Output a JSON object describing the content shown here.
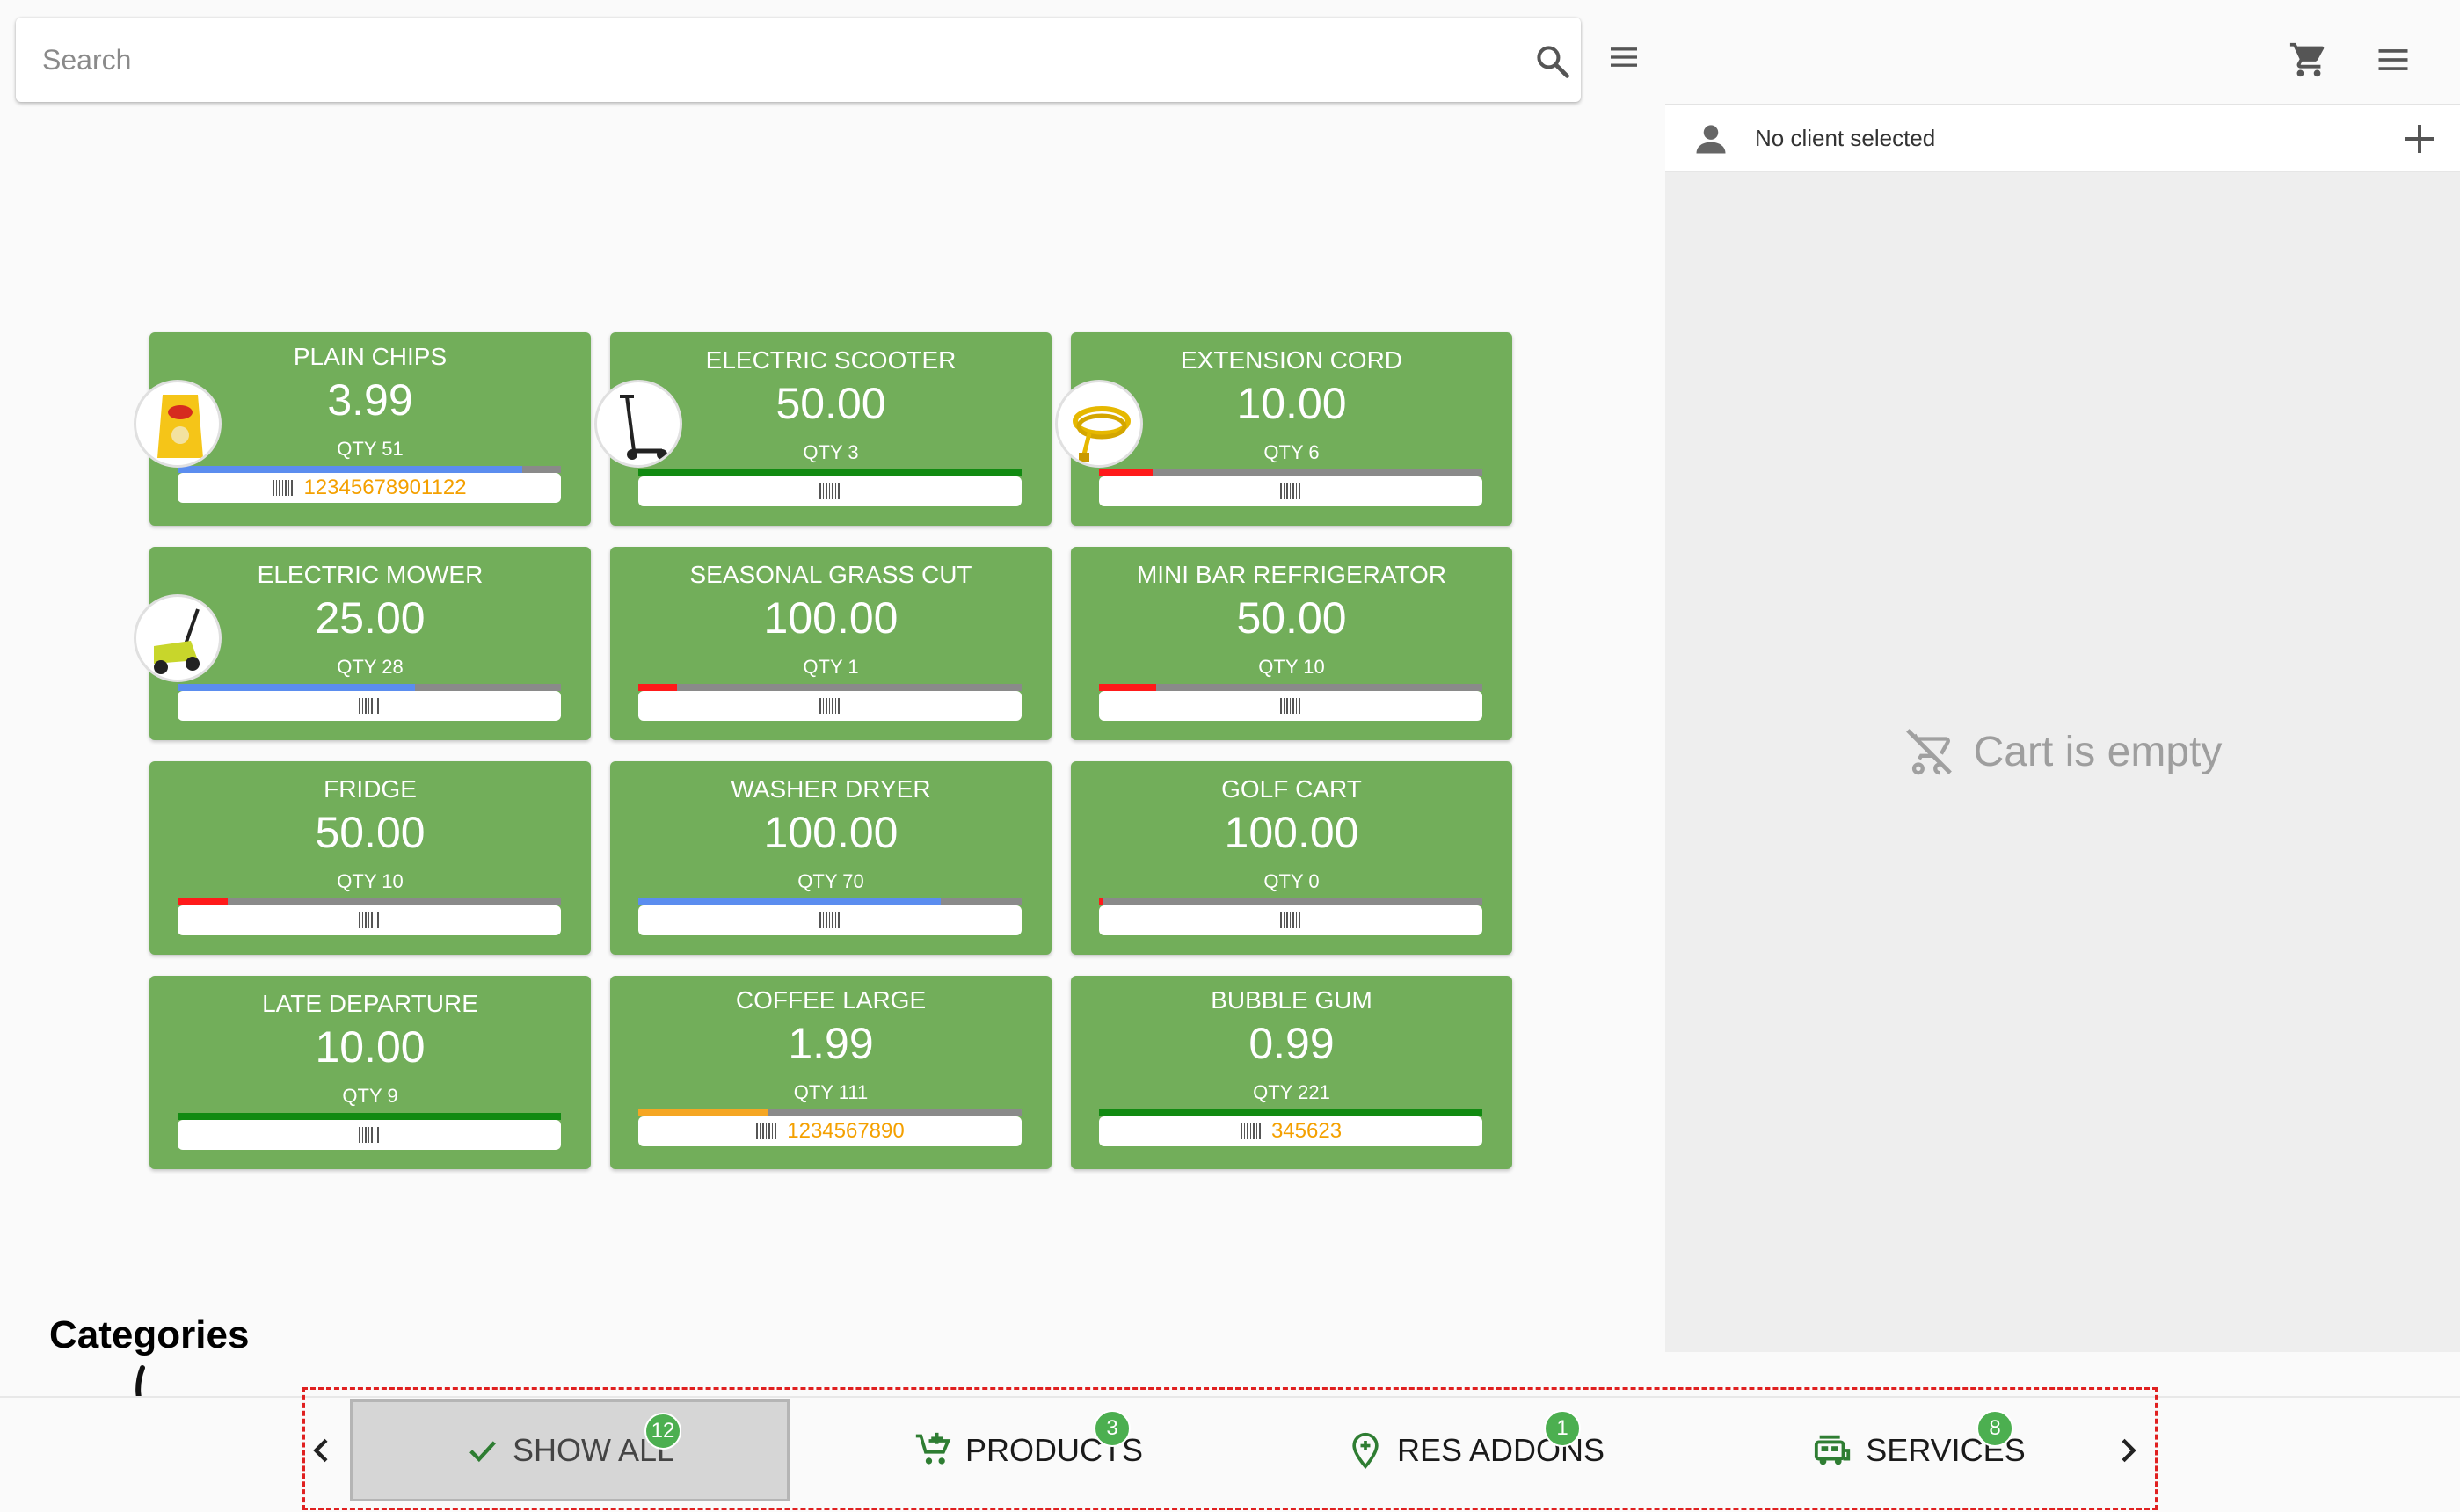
{
  "search": {
    "placeholder": "Search"
  },
  "client": {
    "label": "No client selected"
  },
  "cart": {
    "empty_label": "Cart is empty"
  },
  "colors": {
    "card": "#72ae5a",
    "stock_blue": "#5b8def",
    "stock_green": "#118a11",
    "stock_red": "#ff1a1a",
    "stock_orange": "#f5a623",
    "barcode_text": "#f4a000",
    "badge": "#4caf50"
  },
  "products": [
    {
      "name": "PLAIN CHIPS",
      "price": "3.99",
      "qty": "QTY 51",
      "stock_level": 0.9,
      "stock_color": "#5b8def",
      "barcode": "12345678901122",
      "image": "chips-bag"
    },
    {
      "name": "ELECTRIC SCOOTER",
      "price": "50.00",
      "qty": "QTY 3",
      "stock_level": 1.0,
      "stock_color": "#118a11",
      "barcode": "",
      "image": "scooter"
    },
    {
      "name": "EXTENSION CORD",
      "price": "10.00",
      "qty": "QTY 6",
      "stock_level": 0.14,
      "stock_color": "#ff1a1a",
      "barcode": "",
      "image": "cord"
    },
    {
      "name": "ELECTRIC MOWER",
      "price": "25.00",
      "qty": "QTY 28",
      "stock_level": 0.62,
      "stock_color": "#5b8def",
      "barcode": "",
      "image": "mower"
    },
    {
      "name": "SEASONAL GRASS CUT",
      "price": "100.00",
      "qty": "QTY 1",
      "stock_level": 0.1,
      "stock_color": "#ff1a1a",
      "barcode": "",
      "image": ""
    },
    {
      "name": "MINI BAR REFRIGERATOR",
      "price": "50.00",
      "qty": "QTY 10",
      "stock_level": 0.15,
      "stock_color": "#ff1a1a",
      "barcode": "",
      "image": ""
    },
    {
      "name": "FRIDGE",
      "price": "50.00",
      "qty": "QTY 10",
      "stock_level": 0.13,
      "stock_color": "#ff1a1a",
      "barcode": "",
      "image": ""
    },
    {
      "name": "WASHER DRYER",
      "price": "100.00",
      "qty": "QTY 70",
      "stock_level": 0.79,
      "stock_color": "#5b8def",
      "barcode": "",
      "image": ""
    },
    {
      "name": "GOLF CART",
      "price": "100.00",
      "qty": "QTY 0",
      "stock_level": 0.01,
      "stock_color": "#ff1a1a",
      "barcode": "",
      "image": ""
    },
    {
      "name": "LATE DEPARTURE",
      "price": "10.00",
      "qty": "QTY 9",
      "stock_level": 1.0,
      "stock_color": "#118a11",
      "barcode": "",
      "image": ""
    },
    {
      "name": "COFFEE LARGE",
      "price": "1.99",
      "qty": "QTY 111",
      "stock_level": 0.34,
      "stock_color": "#f5a623",
      "barcode": "1234567890",
      "image": ""
    },
    {
      "name": "BUBBLE GUM",
      "price": "0.99",
      "qty": "QTY 221",
      "stock_level": 1.0,
      "stock_color": "#118a11",
      "barcode": "345623",
      "image": ""
    }
  ],
  "annotation": {
    "label": "Categories"
  },
  "categories": [
    {
      "label": "SHOW ALL",
      "count": "12",
      "icon": "check-icon",
      "selected": true
    },
    {
      "label": "PRODUCTS",
      "count": "3",
      "icon": "cart-plus-icon",
      "selected": false
    },
    {
      "label": "RES ADDONS",
      "count": "1",
      "icon": "location-plus-icon",
      "selected": false
    },
    {
      "label": "SERVICES",
      "count": "8",
      "icon": "rv-icon",
      "selected": false
    }
  ]
}
